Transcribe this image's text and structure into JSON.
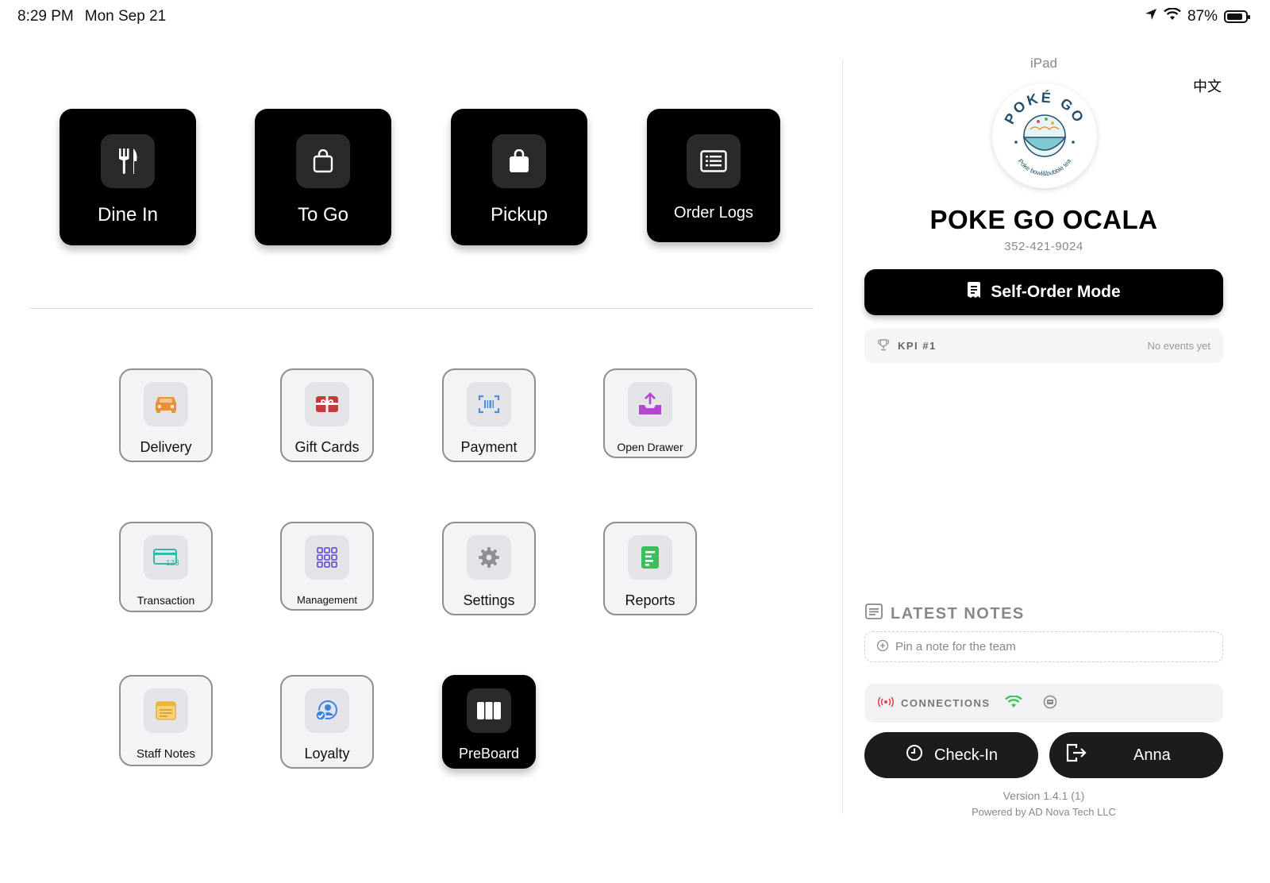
{
  "status_bar": {
    "time": "8:29 PM",
    "date": "Mon Sep 21",
    "battery": "87%",
    "battery_level": 0.87
  },
  "order_types": [
    {
      "label": "Dine In",
      "icon": "fork-knife-icon"
    },
    {
      "label": "To Go",
      "icon": "bag-outline-icon"
    },
    {
      "label": "Pickup",
      "icon": "bag-filled-icon"
    },
    {
      "label": "Order Logs",
      "icon": "list-icon"
    }
  ],
  "tools": [
    {
      "label": "Delivery",
      "icon": "car-icon",
      "color": "#e8913a"
    },
    {
      "label": "Gift Cards",
      "icon": "gift-card-icon",
      "color": "#c9393a"
    },
    {
      "label": "Payment",
      "icon": "barcode-scan-icon",
      "color": "#4a8ee0"
    },
    {
      "label": "Open Drawer",
      "icon": "drawer-icon",
      "color": "#b844d6"
    },
    {
      "label": "Transaction",
      "icon": "card-123-icon",
      "color": "#35b8a6"
    },
    {
      "label": "Management",
      "icon": "grid-icon",
      "color": "#6b57d6"
    },
    {
      "label": "Settings",
      "icon": "gear-icon",
      "color": "#8e8e93"
    },
    {
      "label": "Reports",
      "icon": "report-icon",
      "color": "#3bbf5c"
    },
    {
      "label": "Staff Notes",
      "icon": "notes-icon",
      "color": "#e8b43a"
    },
    {
      "label": "Loyalty",
      "icon": "user-check-icon",
      "color": "#3b82e6"
    },
    {
      "label": "PreBoard",
      "icon": "columns-icon",
      "color": "#ffffff"
    }
  ],
  "panel": {
    "device": "iPad",
    "language": "中文",
    "logo_text": "POKÉ GO",
    "logo_subtext": "Poke bowl&bubble tea",
    "store_name": "POKE GO OCALA",
    "phone": "352-421-9024",
    "self_order_label": "Self-Order Mode",
    "kpi_label": "KPI #1",
    "kpi_status": "No events yet",
    "notes_title": "LATEST NOTES",
    "notes_placeholder": "Pin a note for the team",
    "connections_label": "CONNECTIONS",
    "checkin_label": "Check-In",
    "user_label": "Anna",
    "version": "Version 1.4.1 (1)",
    "powered_by": "Powered by AD Nova Tech LLC"
  },
  "colors": {
    "wifi_ok": "#34c759",
    "broadcast": "#e0434a"
  }
}
